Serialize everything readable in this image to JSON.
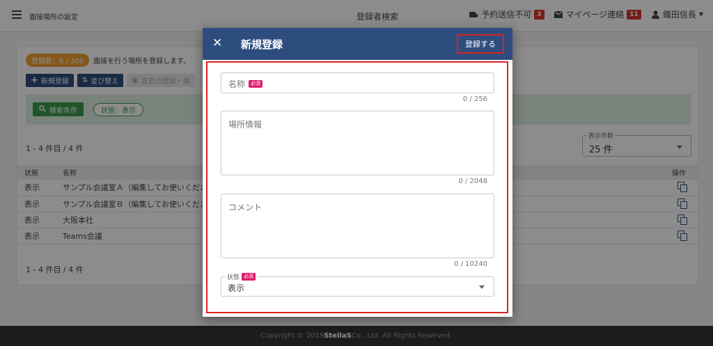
{
  "topbar": {
    "app_title": "面接場所の設定",
    "center_title": "登録者検索",
    "notice_label": "予約送信不可",
    "notice_count": "3",
    "mypage_label": "マイページ連絡",
    "mypage_count": "11",
    "user_name": "織田信長"
  },
  "card": {
    "count_pill": "登録数：6 / 300",
    "count_desc": "面接を行う場所を登録します。",
    "btn_new": "新規登録",
    "btn_sort": "並び替え",
    "btn_recent": "直近の登録・編",
    "filter_btn": "検索条件",
    "status_chip": "状態：表示",
    "range_top": "1 - 4 件目 / 4 件",
    "range_bottom": "1 - 4 件目 / 4 件",
    "perpage_label": "表示件数",
    "perpage_value": "25 件"
  },
  "table": {
    "headers": {
      "status": "状態",
      "name": "名称",
      "op": "操作"
    },
    "rows": [
      {
        "status": "表示",
        "name": "サンプル会議室Ａ（編集してお使いくださ"
      },
      {
        "status": "表示",
        "name": "サンプル会議室Ｂ（編集してお使いくださ"
      },
      {
        "status": "表示",
        "name": "大阪本社"
      },
      {
        "status": "表示",
        "name": "Teams会議"
      }
    ]
  },
  "footer": {
    "prefix": "Copyright © 2019 ",
    "brand": "StellaS",
    "suffix": " Co., Ltd. All Rights Reserved."
  },
  "modal": {
    "close_glyph": "✕",
    "title": "新規登録",
    "submit_label": "登録する",
    "name_placeholder": "名称",
    "required_badge": "必須",
    "name_counter": "0 / 256",
    "place_placeholder": "場所情報",
    "place_counter": "0 / 2048",
    "comment_placeholder": "コメント",
    "comment_counter": "0 / 10240",
    "status_label": "状態",
    "status_value": "表示"
  },
  "colors": {
    "header_navy": "#2e4d7f",
    "highlight_red": "#e02020",
    "count_orange": "#f0a030",
    "filter_green": "#3d9a4f",
    "required_pink": "#e0186c"
  }
}
